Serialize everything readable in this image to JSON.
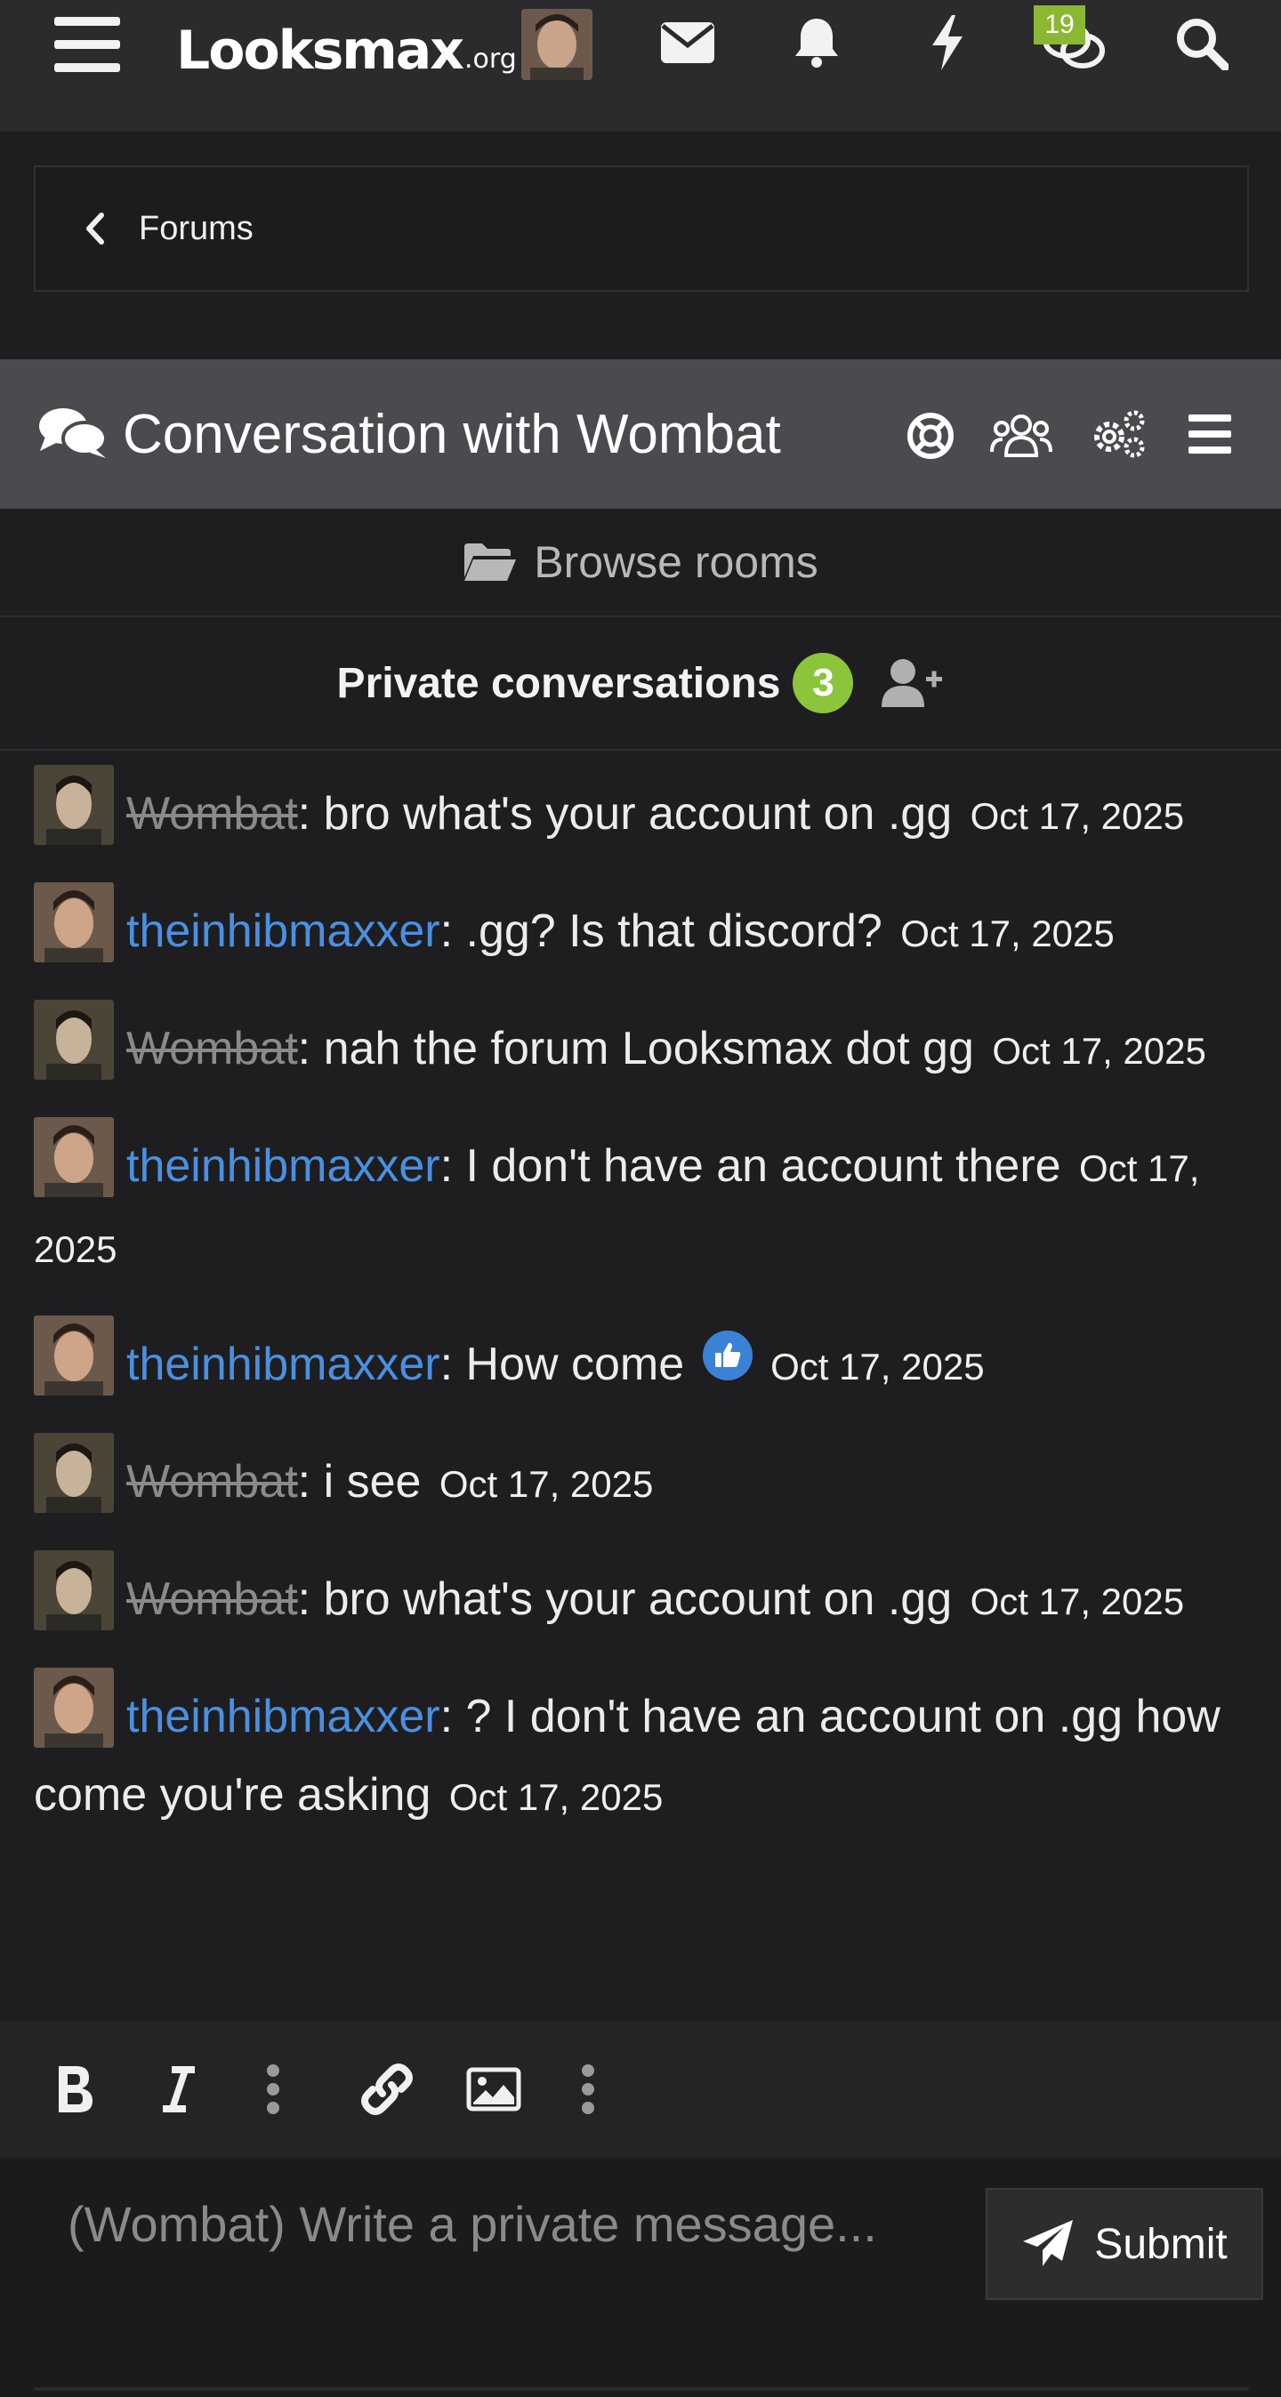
{
  "nav": {
    "logo_main": "Looksmax",
    "logo_tld": ".org",
    "chat_badge": "19"
  },
  "breadcrumb": {
    "label": "Forums"
  },
  "chat": {
    "title": "Conversation with Wombat",
    "browse_rooms": "Browse rooms",
    "private_label": "Private conversations",
    "private_count": "3"
  },
  "messages": [
    {
      "user": "Wombat",
      "text": ": bro what's your account on .gg",
      "time": "Oct 17, 2025"
    },
    {
      "user": "theinhibmaxxer",
      "text": ": .gg? Is that discord?",
      "time": "Oct 17, 2025"
    },
    {
      "user": "Wombat",
      "text": ": nah the forum Looksmax dot gg",
      "time": "Oct 17, 2025"
    },
    {
      "user": "theinhibmaxxer",
      "text": ": I don't have an account there",
      "time": "Oct 17, 2025"
    },
    {
      "user": "theinhibmaxxer",
      "text": ": How come",
      "time": "Oct 17, 2025"
    },
    {
      "user": "Wombat",
      "text": ": i see",
      "time": "Oct 17, 2025"
    },
    {
      "user": "Wombat",
      "text": ": bro what's your account on .gg",
      "time": "Oct 17, 2025"
    },
    {
      "user": "theinhibmaxxer",
      "text": ": ? I don't have an account on .gg how come you're asking",
      "time": "Oct 17, 2025"
    }
  ],
  "compose": {
    "placeholder": "(Wombat) Write a private message...",
    "submit_label": "Submit"
  },
  "colors": {
    "username": "#4a90e2",
    "banned_user": "#8a8a8a",
    "count_badge": "#8cc43b"
  }
}
